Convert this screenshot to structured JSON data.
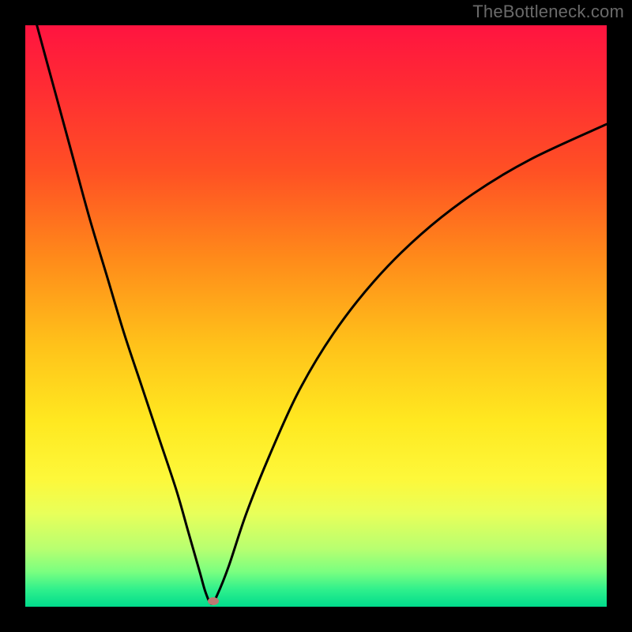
{
  "watermark": "TheBottleneck.com",
  "colors": {
    "background": "#000000",
    "curve_stroke": "#000000",
    "marker_fill": "#bb7a73",
    "gradient_top": "#ff1440",
    "gradient_bottom": "#00dc8c",
    "watermark_text": "#6a6a6a"
  },
  "chart_data": {
    "type": "line",
    "title": "",
    "xlabel": "",
    "ylabel": "",
    "xlim": [
      0,
      100
    ],
    "ylim": [
      0,
      100
    ],
    "grid": false,
    "legend": false,
    "axes_visible": false,
    "description": "V-shaped bottleneck curve over vertical red-to-green gradient; vertex near x≈32, y≈0. Marker sits at the vertex.",
    "x": [
      0,
      2,
      5,
      8,
      11,
      14,
      17,
      20,
      23,
      26,
      28,
      30,
      31,
      32,
      33,
      35,
      38,
      42,
      47,
      53,
      60,
      68,
      77,
      87,
      100
    ],
    "y": [
      108,
      100,
      89,
      78,
      67,
      57,
      47,
      38,
      29,
      20,
      13,
      6,
      2.5,
      0.5,
      2,
      7,
      16,
      26,
      37,
      47,
      56,
      64,
      71,
      77,
      83
    ],
    "marker": {
      "x": 32.3,
      "y": 1.0
    }
  }
}
